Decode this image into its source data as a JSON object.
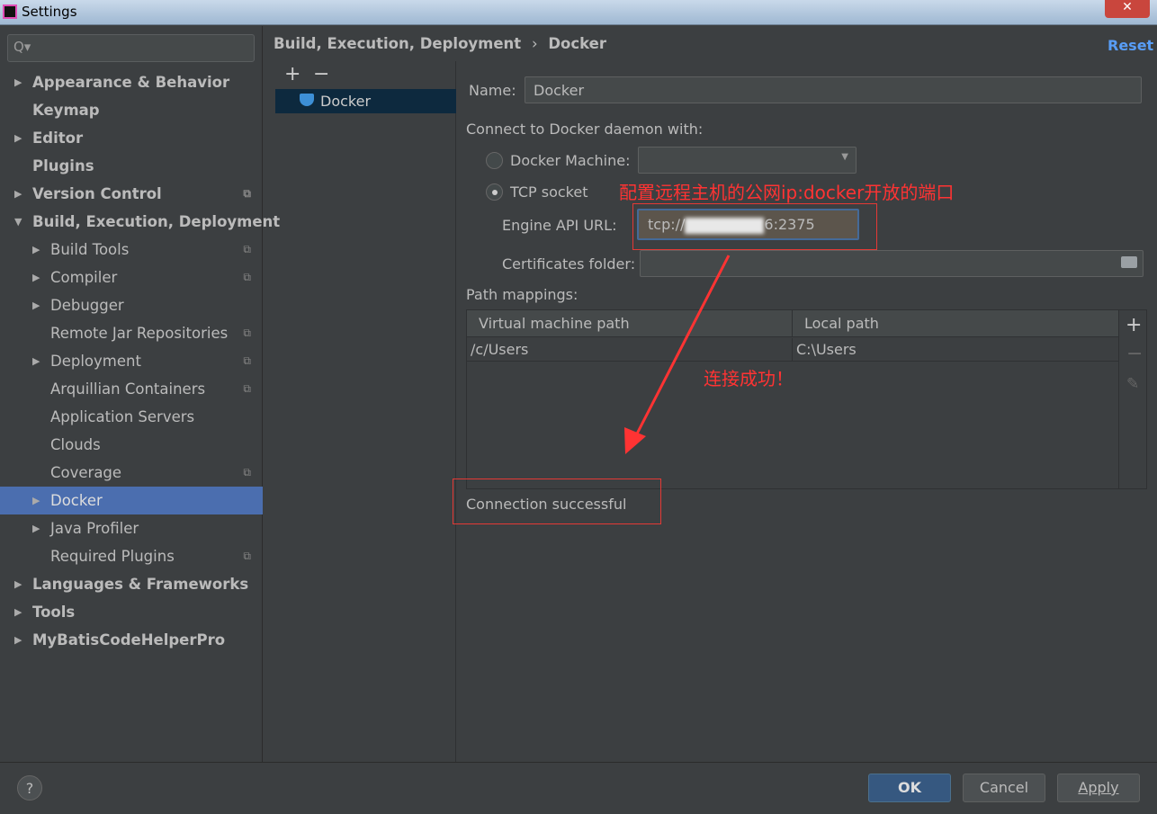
{
  "window": {
    "title": "Settings",
    "close": "✕"
  },
  "search": {
    "placeholder": "Q▾"
  },
  "sidebar": {
    "items": [
      {
        "label": "Appearance & Behavior"
      },
      {
        "label": "Keymap"
      },
      {
        "label": "Editor"
      },
      {
        "label": "Plugins"
      },
      {
        "label": "Version Control"
      },
      {
        "label": "Build, Execution, Deployment"
      },
      {
        "label": "Build Tools"
      },
      {
        "label": "Compiler"
      },
      {
        "label": "Debugger"
      },
      {
        "label": "Remote Jar Repositories"
      },
      {
        "label": "Deployment"
      },
      {
        "label": "Arquillian Containers"
      },
      {
        "label": "Application Servers"
      },
      {
        "label": "Clouds"
      },
      {
        "label": "Coverage"
      },
      {
        "label": "Docker"
      },
      {
        "label": "Java Profiler"
      },
      {
        "label": "Required Plugins"
      },
      {
        "label": "Languages & Frameworks"
      },
      {
        "label": "Tools"
      },
      {
        "label": "MyBatisCodeHelperPro"
      }
    ]
  },
  "breadcrumb": {
    "parent": "Build, Execution, Deployment",
    "sep": "›",
    "current": "Docker"
  },
  "reset_label": "Reset",
  "list": {
    "add": "+",
    "remove": "−",
    "items": [
      "Docker"
    ]
  },
  "form": {
    "name_label": "Name:",
    "name_value": "Docker",
    "connect_label": "Connect to Docker daemon with:",
    "docker_machine_label": "Docker Machine:",
    "tcp_label": "TCP socket",
    "engine_label": "Engine API URL:",
    "engine_prefix": "tcp://",
    "engine_suffix": "6:2375",
    "certs_label": "Certificates folder:",
    "path_mappings_label": "Path mappings:",
    "columns": [
      "Virtual machine path",
      "Local path"
    ],
    "rows": [
      [
        "/c/Users",
        "C:\\Users"
      ]
    ],
    "status": "Connection successful"
  },
  "annotations": {
    "top": "配置远程主机的公网ip:docker开放的端口",
    "middle": "连接成功！"
  },
  "buttons": {
    "help": "?",
    "ok": "OK",
    "cancel": "Cancel",
    "apply": "Apply"
  }
}
